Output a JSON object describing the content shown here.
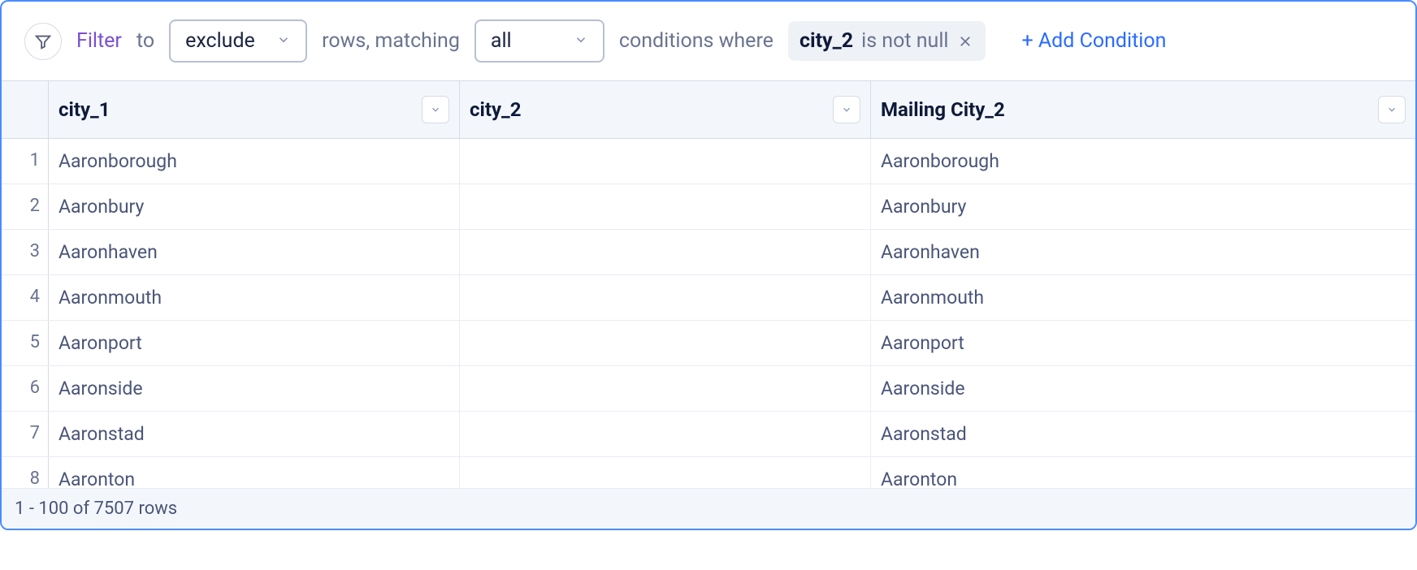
{
  "filter": {
    "label": "Filter",
    "to_label": "to",
    "mode": "exclude",
    "rows_matching_label": "rows, matching",
    "match": "all",
    "conditions_where_label": "conditions where",
    "condition": {
      "field": "city_2",
      "op": "is not null"
    },
    "add_condition_label": "+ Add Condition"
  },
  "columns": [
    {
      "name": "city_1"
    },
    {
      "name": "city_2"
    },
    {
      "name": "Mailing City_2"
    }
  ],
  "rows": [
    {
      "n": "1",
      "city_1": "Aaronborough",
      "city_2": "",
      "mailing_city_2": "Aaronborough"
    },
    {
      "n": "2",
      "city_1": "Aaronbury",
      "city_2": "",
      "mailing_city_2": "Aaronbury"
    },
    {
      "n": "3",
      "city_1": "Aaronhaven",
      "city_2": "",
      "mailing_city_2": "Aaronhaven"
    },
    {
      "n": "4",
      "city_1": "Aaronmouth",
      "city_2": "",
      "mailing_city_2": "Aaronmouth"
    },
    {
      "n": "5",
      "city_1": "Aaronport",
      "city_2": "",
      "mailing_city_2": "Aaronport"
    },
    {
      "n": "6",
      "city_1": "Aaronside",
      "city_2": "",
      "mailing_city_2": "Aaronside"
    },
    {
      "n": "7",
      "city_1": "Aaronstad",
      "city_2": "",
      "mailing_city_2": "Aaronstad"
    },
    {
      "n": "8",
      "city_1": "Aaronton",
      "city_2": "",
      "mailing_city_2": "Aaronton"
    }
  ],
  "status": "1 - 100 of 7507 rows"
}
